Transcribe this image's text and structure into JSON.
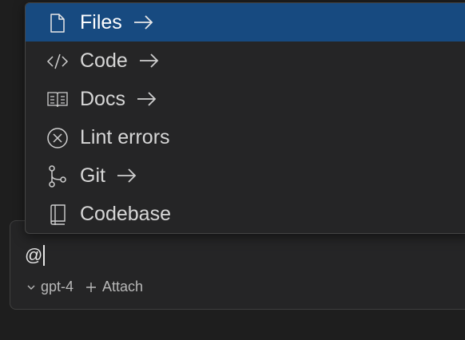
{
  "menu": {
    "items": [
      {
        "id": "files",
        "label": "Files",
        "icon": "file-icon",
        "has_arrow": true,
        "active": true
      },
      {
        "id": "code",
        "label": "Code",
        "icon": "code-icon",
        "has_arrow": true,
        "active": false
      },
      {
        "id": "docs",
        "label": "Docs",
        "icon": "book-icon",
        "has_arrow": true,
        "active": false
      },
      {
        "id": "lint-errors",
        "label": "Lint errors",
        "icon": "x-circle-icon",
        "has_arrow": false,
        "active": false
      },
      {
        "id": "git",
        "label": "Git",
        "icon": "git-branch-icon",
        "has_arrow": true,
        "active": false
      },
      {
        "id": "codebase",
        "label": "Codebase",
        "icon": "repo-icon",
        "has_arrow": false,
        "active": false
      }
    ]
  },
  "composer": {
    "input_value": "@",
    "model_label": "gpt-4",
    "attach_label": "Attach"
  },
  "colors": {
    "background": "#1e1e1e",
    "menu_bg": "#252526",
    "active_bg": "#174a80",
    "text": "#d7d7d7"
  }
}
